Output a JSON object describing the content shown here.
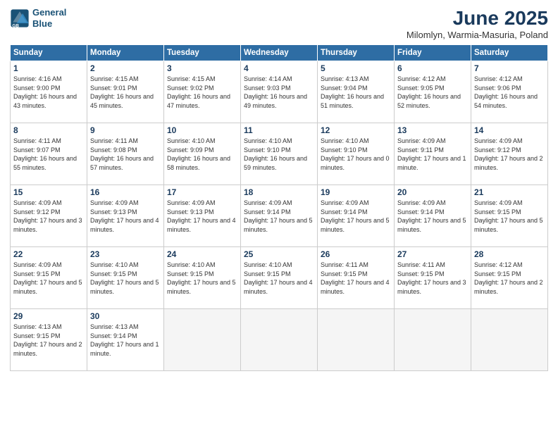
{
  "header": {
    "logo_line1": "General",
    "logo_line2": "Blue",
    "month_title": "June 2025",
    "subtitle": "Milomlyn, Warmia-Masuria, Poland"
  },
  "weekdays": [
    "Sunday",
    "Monday",
    "Tuesday",
    "Wednesday",
    "Thursday",
    "Friday",
    "Saturday"
  ],
  "weeks": [
    [
      {
        "day": "1",
        "sunrise": "4:16 AM",
        "sunset": "9:00 PM",
        "daylight": "16 hours and 43 minutes."
      },
      {
        "day": "2",
        "sunrise": "4:15 AM",
        "sunset": "9:01 PM",
        "daylight": "16 hours and 45 minutes."
      },
      {
        "day": "3",
        "sunrise": "4:15 AM",
        "sunset": "9:02 PM",
        "daylight": "16 hours and 47 minutes."
      },
      {
        "day": "4",
        "sunrise": "4:14 AM",
        "sunset": "9:03 PM",
        "daylight": "16 hours and 49 minutes."
      },
      {
        "day": "5",
        "sunrise": "4:13 AM",
        "sunset": "9:04 PM",
        "daylight": "16 hours and 51 minutes."
      },
      {
        "day": "6",
        "sunrise": "4:12 AM",
        "sunset": "9:05 PM",
        "daylight": "16 hours and 52 minutes."
      },
      {
        "day": "7",
        "sunrise": "4:12 AM",
        "sunset": "9:06 PM",
        "daylight": "16 hours and 54 minutes."
      }
    ],
    [
      {
        "day": "8",
        "sunrise": "4:11 AM",
        "sunset": "9:07 PM",
        "daylight": "16 hours and 55 minutes."
      },
      {
        "day": "9",
        "sunrise": "4:11 AM",
        "sunset": "9:08 PM",
        "daylight": "16 hours and 57 minutes."
      },
      {
        "day": "10",
        "sunrise": "4:10 AM",
        "sunset": "9:09 PM",
        "daylight": "16 hours and 58 minutes."
      },
      {
        "day": "11",
        "sunrise": "4:10 AM",
        "sunset": "9:10 PM",
        "daylight": "16 hours and 59 minutes."
      },
      {
        "day": "12",
        "sunrise": "4:10 AM",
        "sunset": "9:10 PM",
        "daylight": "17 hours and 0 minutes."
      },
      {
        "day": "13",
        "sunrise": "4:09 AM",
        "sunset": "9:11 PM",
        "daylight": "17 hours and 1 minute."
      },
      {
        "day": "14",
        "sunrise": "4:09 AM",
        "sunset": "9:12 PM",
        "daylight": "17 hours and 2 minutes."
      }
    ],
    [
      {
        "day": "15",
        "sunrise": "4:09 AM",
        "sunset": "9:12 PM",
        "daylight": "17 hours and 3 minutes."
      },
      {
        "day": "16",
        "sunrise": "4:09 AM",
        "sunset": "9:13 PM",
        "daylight": "17 hours and 4 minutes."
      },
      {
        "day": "17",
        "sunrise": "4:09 AM",
        "sunset": "9:13 PM",
        "daylight": "17 hours and 4 minutes."
      },
      {
        "day": "18",
        "sunrise": "4:09 AM",
        "sunset": "9:14 PM",
        "daylight": "17 hours and 5 minutes."
      },
      {
        "day": "19",
        "sunrise": "4:09 AM",
        "sunset": "9:14 PM",
        "daylight": "17 hours and 5 minutes."
      },
      {
        "day": "20",
        "sunrise": "4:09 AM",
        "sunset": "9:14 PM",
        "daylight": "17 hours and 5 minutes."
      },
      {
        "day": "21",
        "sunrise": "4:09 AM",
        "sunset": "9:15 PM",
        "daylight": "17 hours and 5 minutes."
      }
    ],
    [
      {
        "day": "22",
        "sunrise": "4:09 AM",
        "sunset": "9:15 PM",
        "daylight": "17 hours and 5 minutes."
      },
      {
        "day": "23",
        "sunrise": "4:10 AM",
        "sunset": "9:15 PM",
        "daylight": "17 hours and 5 minutes."
      },
      {
        "day": "24",
        "sunrise": "4:10 AM",
        "sunset": "9:15 PM",
        "daylight": "17 hours and 5 minutes."
      },
      {
        "day": "25",
        "sunrise": "4:10 AM",
        "sunset": "9:15 PM",
        "daylight": "17 hours and 4 minutes."
      },
      {
        "day": "26",
        "sunrise": "4:11 AM",
        "sunset": "9:15 PM",
        "daylight": "17 hours and 4 minutes."
      },
      {
        "day": "27",
        "sunrise": "4:11 AM",
        "sunset": "9:15 PM",
        "daylight": "17 hours and 3 minutes."
      },
      {
        "day": "28",
        "sunrise": "4:12 AM",
        "sunset": "9:15 PM",
        "daylight": "17 hours and 2 minutes."
      }
    ],
    [
      {
        "day": "29",
        "sunrise": "4:13 AM",
        "sunset": "9:15 PM",
        "daylight": "17 hours and 2 minutes."
      },
      {
        "day": "30",
        "sunrise": "4:13 AM",
        "sunset": "9:14 PM",
        "daylight": "17 hours and 1 minute."
      },
      null,
      null,
      null,
      null,
      null
    ]
  ]
}
